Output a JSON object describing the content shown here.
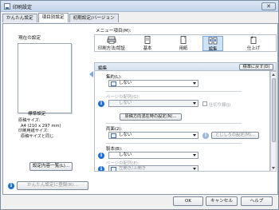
{
  "window": {
    "title": "印刷設定",
    "close_glyph": "✕"
  },
  "tabs": [
    {
      "label": "かんたん設定"
    },
    {
      "label": "項目別設定"
    },
    {
      "label": "初期設定/バージョン"
    }
  ],
  "left": {
    "current_label": "現在の設定",
    "standard_label": "標準設定",
    "info_lines": [
      "原稿サイズ:",
      "A4 (210 x 297 mm)",
      "印刷用紙サイズ:",
      "原稿サイズと同じ"
    ],
    "list_button": "設定内容一覧(L)...",
    "register_button": "かんたん設定に登録(R)..."
  },
  "menu": {
    "label": "メニュー項目(M):",
    "items": [
      {
        "label": "印刷方法/認証",
        "icon": "print-method-icon"
      },
      {
        "label": "基本",
        "icon": "basic-icon"
      },
      {
        "label": "用紙",
        "icon": "paper-icon"
      },
      {
        "label": "編集",
        "icon": "edit-icon"
      },
      {
        "label": "仕上げ",
        "icon": "finishing-icon"
      }
    ]
  },
  "edit": {
    "title": "編集",
    "default_button": "標準に戻す(D)",
    "aggregate_label": "集約(L):",
    "aggregate_value": "しない",
    "page_order_label": "ページの配列(G):",
    "page_order_value": "しない",
    "divider_label": "仕切り線(J)",
    "orientation_button": "原稿方向混在時の設定(N)...",
    "duplex_label": "両面(2):",
    "duplex_value": "しない",
    "binding_button": "とじしろの設定(M)...",
    "booklet_label": "製本(B):",
    "booklet_value": "しない",
    "page_order2_label": "ページの配列(E):",
    "page_order2_value": "左開き/上開き"
  },
  "footer": {
    "ok": "OK",
    "cancel": "キャンセル",
    "help": "ヘルプ"
  },
  "colors": {
    "accent": "#1f6fd1",
    "selected_menu": "#cfe3f7"
  }
}
